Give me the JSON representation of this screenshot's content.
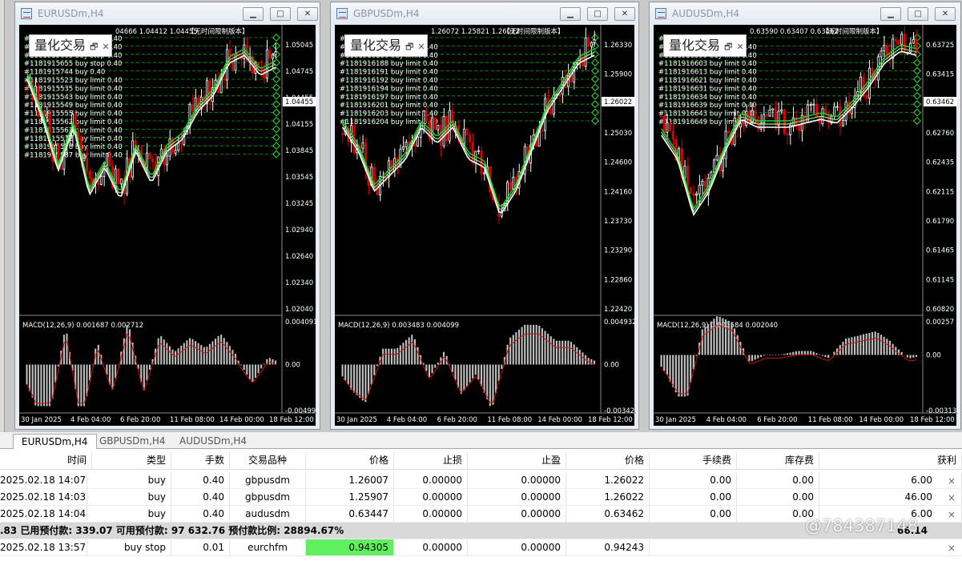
{
  "windows": [
    {
      "title": "EURUSDm,H4",
      "watermark": "量化交易",
      "info": "04666 1.04412 1.04455",
      "badge": "【无时间限制版本】",
      "price_label": "1.04455",
      "yticks": [
        "1.05045",
        "1.04745",
        "1.04455",
        "1.04155",
        "1.03845",
        "1.03545",
        "1.03245",
        "1.02940",
        "1.02640",
        "1.02340",
        "1.02040"
      ],
      "macd_label": "MACD(12,26,9) 0.001687 0.002712",
      "macd_ticks": [
        "0.004091",
        "0.00",
        "-0.004998"
      ],
      "xticks": [
        "30 Jan 2025",
        "4 Feb 04:00",
        "6 Feb 20:00",
        "11 Feb 08:00",
        "14 Feb 00:00",
        "18 Feb 12:00"
      ],
      "orders": [
        "#1181915672 buy stop 0.40",
        "#1181915668 buy stop 0.40",
        "#1181915663 buy stop 0.40",
        "#1181915655 buy stop 0.40",
        "#1181915744 buy 0.40",
        "#1181915523 buy limit 0.40",
        "#1181915535 buy limit 0.40",
        "#1181915543 buy limit 0.40",
        "#1181915549 buy limit 0.40",
        "#1181915555 buy limit 0.40",
        "#1181915562 buy limit 0.40",
        "#1181915567 buy limit 0.40",
        "#1181915572 buy limit 0.40",
        "#1181915578 buy limit 0.40",
        "#1181915587 buy limit 0.40"
      ]
    },
    {
      "title": "GBPUSDm,H4",
      "watermark": "量化交易",
      "info": "1.26072 1.25821 1.26022",
      "badge": "【无时间限制版本】",
      "price_label": "1.26022",
      "yticks": [
        "1.26330",
        "1.25900",
        "1.25460",
        "1.25030",
        "1.24600",
        "1.24160",
        "1.23730",
        "1.23290",
        "1.22860",
        "1.22420"
      ],
      "macd_label": "MACD(12,26,9) 0.003483 0.004099",
      "macd_ticks": [
        "0.004932",
        "0.00",
        "-0.00342"
      ],
      "xticks": [
        "30 Jan 2025",
        "4 Feb 04:00",
        "6 Feb 20:00",
        "11 Feb 08:00",
        "14 Feb 00:00",
        "18 Feb 12:00"
      ],
      "orders": [
        "#1181916297 buy 0.40",
        "#1181916183 buy limit 0.40",
        "#1181916186 buy limit 0.40",
        "#1181916188 buy limit 0.40",
        "#1181916191 buy limit 0.40",
        "#1181916192 buy limit 0.40",
        "#1181916194 buy limit 0.40",
        "#1181916197 buy limit 0.40",
        "#1181916201 buy limit 0.40",
        "#1181916203 buy limit 0.40",
        "#1181916204 buy limit 0.40"
      ]
    },
    {
      "title": "AUDUSDm,H4",
      "watermark": "量化交易",
      "info": "0.63590 0.63407 0.63462",
      "badge": "【无时间限制版本】",
      "price_label": "0.63462",
      "yticks": [
        "0.63725",
        "0.63415",
        "0.63080",
        "0.62760",
        "0.62435",
        "0.62115",
        "0.61790",
        "0.61465",
        "0.61145",
        "0.60820"
      ],
      "macd_label": "MACD(12,26,9) 0.001584 0.002040",
      "macd_ticks": [
        "0.00257",
        "0.00",
        "-0.003135"
      ],
      "xticks": [
        "30 Jan 2025",
        "4 Feb 04:00",
        "6 Feb 20:00",
        "11 Feb 08:00",
        "14 Feb 00:00",
        "18 Feb 12:00"
      ],
      "orders": [
        "#1181916738 buy 0.40",
        "#1181916593 buy limit 0.40",
        "#1181916599 buy limit 0.40",
        "#1181916603 buy limit 0.40",
        "#1181916613 buy limit 0.40",
        "#1181916621 buy limit 0.40",
        "#1181916631 buy limit 0.40",
        "#1181916634 buy limit 0.40",
        "#1181916639 buy limit 0.40",
        "#1181916643 buy limit 0.40",
        "#1181916649 buy limit 0.40"
      ]
    }
  ],
  "tabs": [
    "EURUSDm,H4",
    "GBPUSDm,H4",
    "AUDUSDm,H4"
  ],
  "columns": [
    "时间",
    "类型",
    "手数",
    "交易品种",
    "价格",
    "止损",
    "止盈",
    "价格",
    "手续费",
    "库存费",
    "获利"
  ],
  "rows": [
    [
      "2025.02.18 14:07:00",
      "buy",
      "0.40",
      "gbpusdm",
      "1.26007",
      "0.00000",
      "0.00000",
      "1.26022",
      "0.00",
      "0.00",
      "6.00"
    ],
    [
      "2025.02.18 14:03:46",
      "buy",
      "0.40",
      "gbpusdm",
      "1.25907",
      "0.00000",
      "0.00000",
      "1.26022",
      "0.00",
      "0.00",
      "46.00"
    ],
    [
      "2025.02.18 14:04:12",
      "buy",
      "0.40",
      "audusdm",
      "0.63447",
      "0.00000",
      "0.00000",
      "0.63462",
      "0.00",
      "0.00",
      "6.00"
    ]
  ],
  "summary": ".83  已用预付款: 339.07  可用预付款: 97 632.76  预付款比例: 28894.67%",
  "summary_profit": "66.14",
  "pending": [
    "2025.02.18 13:57:10",
    "buy stop",
    "0.01",
    "eurchfm",
    "0.94305",
    "0.00000",
    "0.00000",
    "0.94243"
  ],
  "close_icon": "×",
  "watermark_text": "@784387148",
  "colors": {
    "bull": "#00c000",
    "bear": "#e00000",
    "chart_bg": "#000000",
    "order_line": "#00b000",
    "ma_white": "#ffffff",
    "ma_green": "#27d327",
    "macd_signal": "#d01010",
    "macd_hist": "#c0c0c0"
  }
}
